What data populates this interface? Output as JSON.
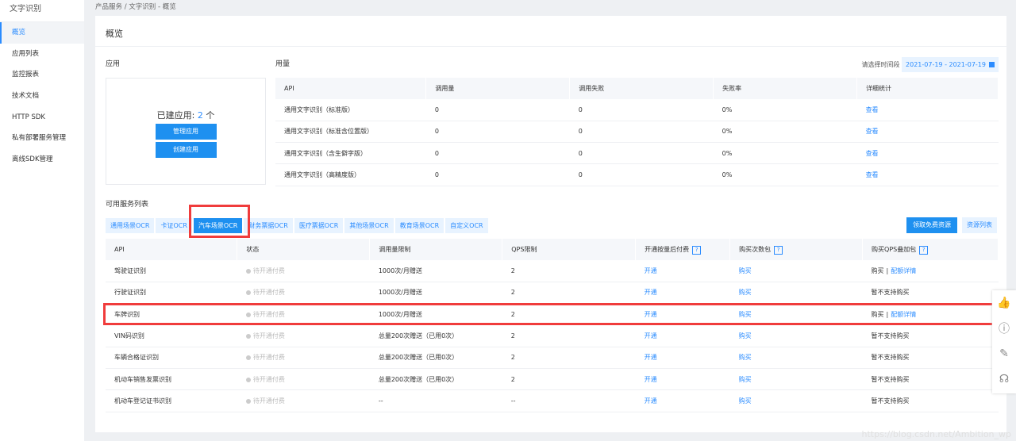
{
  "sidebar": {
    "title": "文字识别",
    "items": [
      {
        "label": "概览",
        "active": true
      },
      {
        "label": "应用列表"
      },
      {
        "label": "监控报表"
      },
      {
        "label": "技术文档"
      },
      {
        "label": "HTTP SDK"
      },
      {
        "label": "私有部署服务管理"
      },
      {
        "label": "离线SDK管理"
      }
    ]
  },
  "breadcrumb": "产品服务 / 文字识别 - 概览",
  "page_title": "概览",
  "apps": {
    "title": "应用",
    "count_label": "已建应用:",
    "count": "2",
    "unit": "个",
    "manage": "管理应用",
    "create": "创建应用"
  },
  "usage": {
    "title": "用量",
    "date_label": "请选择时间段",
    "date_range": "2021-07-19 - 2021-07-19",
    "columns": [
      "API",
      "调用量",
      "调用失败",
      "失败率",
      "详细统计"
    ],
    "rows": [
      [
        "通用文字识别（标准版）",
        "0",
        "0",
        "0%",
        "查看"
      ],
      [
        "通用文字识别（标准含位置版）",
        "0",
        "0",
        "0%",
        "查看"
      ],
      [
        "通用文字识别（含生僻字版）",
        "0",
        "0",
        "0%",
        "查看"
      ],
      [
        "通用文字识别（高精度版）",
        "0",
        "0",
        "0%",
        "查看"
      ]
    ]
  },
  "services": {
    "title": "可用服务列表",
    "tabs": [
      "通用场景OCR",
      "卡证OCR",
      "汽车场景OCR",
      "财务票据OCR",
      "医疗票据OCR",
      "其他场景OCR",
      "教育场景OCR",
      "自定义OCR"
    ],
    "active_tab": 2,
    "free_btn": "领取免费资源",
    "resource_btn": "资源列表",
    "columns": [
      "API",
      "状态",
      "调用量限制",
      "QPS限制",
      "开通按量后付费",
      "购买次数包",
      "购买QPS叠加包"
    ],
    "help": "?",
    "rows": [
      {
        "api": "驾驶证识别",
        "status": "待开通付费",
        "limit": "1000次/月赠送",
        "qps": "2",
        "open": "开通",
        "buy": "购买",
        "qps_buy": "购买",
        "qps_sep": "|",
        "qps_link": "配额详情"
      },
      {
        "api": "行驶证识别",
        "status": "待开通付费",
        "limit": "1000次/月赠送",
        "qps": "2",
        "open": "开通",
        "buy": "购买",
        "qps_text": "暂不支持购买"
      },
      {
        "api": "车牌识别",
        "status": "待开通付费",
        "limit": "1000次/月赠送",
        "qps": "2",
        "open": "开通",
        "buy": "购买",
        "qps_buy": "购买",
        "qps_sep": "|",
        "qps_link": "配额详情"
      },
      {
        "api": "VIN码识别",
        "status": "待开通付费",
        "limit": "总量200次赠送（已用0次）",
        "qps": "2",
        "open": "开通",
        "buy": "购买",
        "qps_text": "暂不支持购买"
      },
      {
        "api": "车辆合格证识别",
        "status": "待开通付费",
        "limit": "总量200次赠送（已用0次）",
        "qps": "2",
        "open": "开通",
        "buy": "购买",
        "qps_text": "暂不支持购买"
      },
      {
        "api": "机动车销售发票识别",
        "status": "待开通付费",
        "limit": "总量200次赠送（已用0次）",
        "qps": "2",
        "open": "开通",
        "buy": "购买",
        "qps_text": "暂不支持购买"
      },
      {
        "api": "机动车登记证书识别",
        "status": "待开通付费",
        "limit": "--",
        "qps": "--",
        "open": "开通",
        "buy": "购买",
        "qps_text": "暂不支持购买"
      }
    ]
  },
  "float_icons": [
    "thumbs-up-icon",
    "help-icon",
    "edit-icon",
    "headset-icon"
  ],
  "watermark": "https://blog.csdn.net/Ambition_wp",
  "colors": {
    "accent": "#1e90f0",
    "highlight": "#f03c3c"
  }
}
